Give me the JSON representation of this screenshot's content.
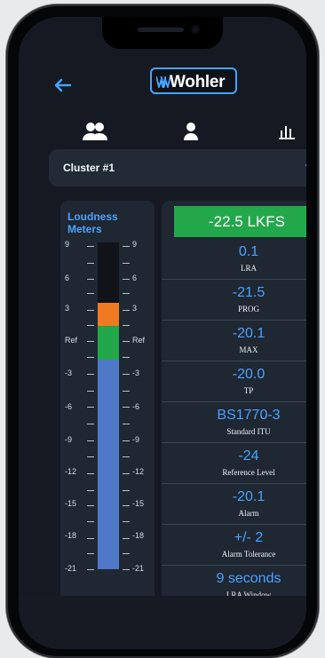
{
  "app": {
    "logo_text": "Wohler"
  },
  "top_icons": {
    "users": "users-icon",
    "user": "user-icon",
    "chart": "bar-chart-icon"
  },
  "cluster": {
    "selected": "Cluster #1"
  },
  "left_panel": {
    "title": "Loudness Meters",
    "scale_left": [
      "9",
      "6",
      "3",
      "Ref",
      "-3",
      "-6",
      "-9",
      "-12",
      "-15",
      "-18",
      "-21"
    ],
    "scale_right": [
      "9",
      "6",
      "3",
      "Ref",
      "-3",
      "-6",
      "-9",
      "-12",
      "-15",
      "-18",
      "-21"
    ]
  },
  "right_panel": {
    "lkfs": "-22.5 LKFS",
    "rows": [
      {
        "value": "0.1",
        "label": "LRA"
      },
      {
        "value": "-21.5",
        "label": "PROG"
      },
      {
        "value": "-20.1",
        "label": "MAX"
      },
      {
        "value": "-20.0",
        "label": "TP"
      },
      {
        "value": "BS1770-3",
        "label": "Standard ITU"
      },
      {
        "value": "-24",
        "label": "Reference Level"
      },
      {
        "value": "-20.1",
        "label": "Alarm"
      },
      {
        "value": "+/- 2",
        "label": "Alarm Tolerance"
      },
      {
        "value": "9 seconds",
        "label": "LRA Window"
      }
    ]
  },
  "colors": {
    "accent": "#4aa3ff",
    "panel": "#1f2733",
    "meter_blue": "#4f79c8",
    "meter_green": "#21a64a",
    "meter_orange": "#f07a22",
    "lkfs_green": "#22a84a"
  }
}
